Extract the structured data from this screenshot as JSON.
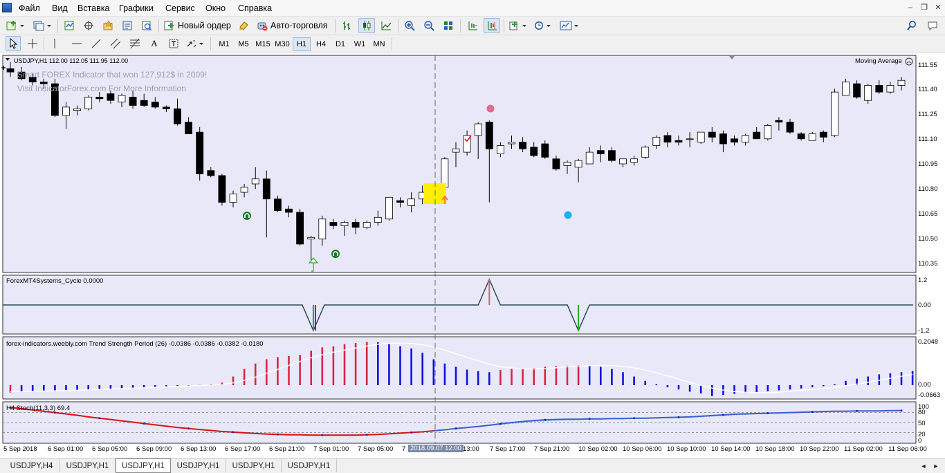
{
  "menu": {
    "items": [
      "Файл",
      "Вид",
      "Вставка",
      "Графики",
      "Сервис",
      "Окно",
      "Справка"
    ]
  },
  "toolbar": {
    "new_order": "Новый ордер",
    "auto_trading": "Авто-торговля"
  },
  "timeframes": {
    "items": [
      "M1",
      "M5",
      "M15",
      "M30",
      "H1",
      "H4",
      "D1",
      "W1",
      "MN"
    ],
    "selected": "H1"
  },
  "chart": {
    "header": "USDJPY,H1  112.00 112.05 111.95 112.00",
    "ad_line1": "Smart FOREX Indicator that won 127,912$ in 2009!",
    "ad_line2": "Visit IndicatorForex.com For More Information",
    "indicator_label": "Moving Average",
    "price_scale": [
      "111.55",
      "111.40",
      "111.25",
      "111.10",
      "110.95",
      "110.80",
      "110.65",
      "110.50",
      "110.35"
    ],
    "cycle": {
      "title": "ForexMT4Systems_Cycle 0.0000",
      "scale": [
        "1.2",
        "0.00",
        "-1.2"
      ]
    },
    "trend": {
      "title": "forex-indicators.weebly.com Trend Strength Period (26) -0.0386 -0.0386 -0.0382 -0.0180",
      "scale": [
        "0.2048",
        "0.00",
        "-0.0663"
      ]
    },
    "stoch": {
      "title": "H4 Stoch(11,3,3)  69.4",
      "scale": [
        "100",
        "80",
        "50",
        "20",
        "0"
      ]
    },
    "time_axis": [
      "5 Sep 2018",
      "6 Sep 01:00",
      "6 Sep 05:00",
      "6 Sep 09:00",
      "6 Sep 13:00",
      "6 Sep 17:00",
      "6 Sep 21:00",
      "7 Sep 01:00",
      "7 Sep 05:00",
      "7",
      "13:00",
      "7 Sep 17:00",
      "7 Sep 21:00",
      "10 Sep 02:00",
      "10 Sep 06:00",
      "10 Sep 10:00",
      "10 Sep 14:00",
      "10 Sep 18:00",
      "10 Sep 22:00",
      "11 Sep 02:00",
      "11 Sep 06:00"
    ],
    "crosshair_time": "2018.09.07 12:00"
  },
  "chart_data": {
    "type": "candlestick",
    "symbol": "USDJPY",
    "timeframe": "H1",
    "ylim": [
      110.3,
      111.6
    ],
    "candles": [
      [
        111.52,
        111.56,
        111.47,
        111.5
      ],
      [
        111.5,
        111.53,
        111.45,
        111.46
      ],
      [
        111.47,
        111.49,
        111.42,
        111.44
      ],
      [
        111.44,
        111.46,
        111.4,
        111.43
      ],
      [
        111.43,
        111.46,
        111.23,
        111.24
      ],
      [
        111.24,
        111.32,
        111.16,
        111.29
      ],
      [
        111.27,
        111.3,
        111.24,
        111.28
      ],
      [
        111.28,
        111.36,
        111.27,
        111.35
      ],
      [
        111.35,
        111.38,
        111.32,
        111.34
      ],
      [
        111.37,
        111.39,
        111.31,
        111.33
      ],
      [
        111.32,
        111.37,
        111.29,
        111.36
      ],
      [
        111.35,
        111.39,
        111.28,
        111.3
      ],
      [
        111.33,
        111.37,
        111.29,
        111.3
      ],
      [
        111.32,
        111.35,
        111.28,
        111.29
      ],
      [
        111.29,
        111.3,
        111.26,
        111.28
      ],
      [
        111.28,
        111.34,
        111.18,
        111.19
      ],
      [
        111.2,
        111.23,
        111.13,
        111.13
      ],
      [
        111.14,
        111.17,
        110.85,
        110.89
      ],
      [
        110.91,
        110.93,
        110.87,
        110.88
      ],
      [
        110.88,
        110.89,
        110.7,
        110.72
      ],
      [
        110.72,
        110.79,
        110.69,
        110.77
      ],
      [
        110.78,
        110.83,
        110.75,
        110.81
      ],
      [
        110.83,
        110.93,
        110.8,
        110.86
      ],
      [
        110.86,
        110.91,
        110.51,
        110.74
      ],
      [
        110.74,
        110.76,
        110.66,
        110.67
      ],
      [
        110.68,
        110.7,
        110.63,
        110.66
      ],
      [
        110.66,
        110.68,
        110.46,
        110.47
      ],
      [
        110.5,
        110.52,
        110.36,
        110.51
      ],
      [
        110.5,
        110.64,
        110.46,
        110.62
      ],
      [
        110.6,
        110.62,
        110.56,
        110.58
      ],
      [
        110.58,
        110.61,
        110.52,
        110.6
      ],
      [
        110.6,
        110.62,
        110.53,
        110.57
      ],
      [
        110.57,
        110.61,
        110.56,
        110.6
      ],
      [
        110.6,
        110.67,
        110.58,
        110.63
      ],
      [
        110.62,
        110.75,
        110.61,
        110.75
      ],
      [
        110.73,
        110.75,
        110.69,
        110.72
      ],
      [
        110.7,
        110.78,
        110.66,
        110.74
      ],
      [
        110.74,
        110.82,
        110.71,
        110.78
      ],
      [
        110.78,
        110.82,
        110.76,
        110.8
      ],
      [
        110.81,
        110.99,
        110.8,
        110.98
      ],
      [
        111.02,
        111.08,
        110.93,
        111.04
      ],
      [
        111.02,
        111.15,
        111.0,
        111.12
      ],
      [
        111.12,
        111.2,
        110.98,
        111.19
      ],
      [
        111.2,
        111.21,
        110.72,
        111.04
      ],
      [
        111.01,
        111.08,
        110.99,
        111.06
      ],
      [
        111.07,
        111.12,
        111.04,
        111.08
      ],
      [
        111.08,
        111.11,
        111.02,
        111.04
      ],
      [
        111.05,
        111.08,
        110.99,
        111.0
      ],
      [
        111.07,
        111.09,
        110.98,
        110.99
      ],
      [
        110.98,
        111.0,
        110.91,
        110.92
      ],
      [
        110.94,
        110.97,
        110.89,
        110.96
      ],
      [
        110.93,
        110.98,
        110.84,
        110.97
      ],
      [
        110.95,
        111.05,
        110.95,
        111.02
      ],
      [
        111.03,
        111.06,
        110.96,
        111.01
      ],
      [
        111.03,
        111.05,
        110.96,
        110.97
      ],
      [
        110.95,
        110.98,
        110.93,
        110.98
      ],
      [
        110.96,
        111.0,
        110.94,
        110.98
      ],
      [
        110.99,
        111.06,
        110.98,
        111.05
      ],
      [
        111.06,
        111.12,
        111.04,
        111.11
      ],
      [
        111.12,
        111.14,
        111.05,
        111.08
      ],
      [
        111.09,
        111.12,
        111.06,
        111.08
      ],
      [
        111.1,
        111.14,
        111.05,
        111.1
      ],
      [
        111.08,
        111.14,
        111.07,
        111.14
      ],
      [
        111.14,
        111.17,
        111.08,
        111.11
      ],
      [
        111.13,
        111.15,
        111.02,
        111.07
      ],
      [
        111.1,
        111.12,
        111.06,
        111.08
      ],
      [
        111.08,
        111.13,
        111.06,
        111.12
      ],
      [
        111.14,
        111.17,
        111.1,
        111.1
      ],
      [
        111.1,
        111.19,
        111.09,
        111.18
      ],
      [
        111.21,
        111.23,
        111.15,
        111.2
      ],
      [
        111.2,
        111.22,
        111.13,
        111.14
      ],
      [
        111.13,
        111.14,
        111.09,
        111.1
      ],
      [
        111.09,
        111.14,
        111.09,
        111.13
      ],
      [
        111.14,
        111.15,
        111.08,
        111.11
      ],
      [
        111.12,
        111.4,
        111.11,
        111.38
      ],
      [
        111.36,
        111.46,
        111.36,
        111.44
      ],
      [
        111.43,
        111.45,
        111.34,
        111.35
      ],
      [
        111.33,
        111.43,
        111.31,
        111.42
      ],
      [
        111.42,
        111.45,
        111.37,
        111.38
      ],
      [
        111.38,
        111.44,
        111.37,
        111.42
      ],
      [
        111.42,
        111.47,
        111.39,
        111.45
      ]
    ],
    "cycle": {
      "range": [
        -1.2,
        1.2
      ],
      "dips": [
        {
          "candle": 27.2,
          "value": -1.2
        },
        {
          "candle": 51,
          "value": -1.2
        }
      ],
      "peaks": [
        {
          "candle": 43,
          "value": 1.2
        }
      ]
    },
    "trend_strength": {
      "range": [
        -0.0663,
        0.2048
      ],
      "values": [
        -0.034,
        -0.032,
        -0.03,
        -0.028,
        -0.026,
        -0.024,
        -0.022,
        -0.02,
        -0.018,
        -0.016,
        -0.014,
        -0.012,
        -0.01,
        -0.008,
        -0.006,
        -0.004,
        -0.002,
        0.002,
        0.006,
        0.012,
        0.04,
        0.075,
        0.1,
        0.12,
        0.13,
        0.135,
        0.14,
        0.16,
        0.175,
        0.18,
        0.19,
        0.195,
        0.2,
        0.198,
        0.19,
        0.18,
        0.17,
        0.15,
        0.12,
        0.1,
        0.085,
        0.072,
        0.065,
        0.06,
        0.07,
        0.075,
        0.078,
        0.08,
        0.085,
        0.088,
        0.09,
        0.092,
        0.09,
        0.085,
        0.075,
        0.06,
        0.04,
        0.02,
        0.005,
        -0.01,
        -0.02,
        -0.03,
        -0.038,
        -0.05,
        -0.045,
        -0.04,
        -0.036,
        -0.032,
        -0.028,
        -0.024,
        -0.02,
        -0.015,
        -0.01,
        -0.005,
        0.005,
        0.02,
        0.03,
        0.04,
        0.05,
        0.055,
        0.06,
        0.065
      ]
    },
    "stoch_main": [
      95,
      92,
      88,
      84,
      80,
      76,
      72,
      67,
      63,
      59,
      55,
      51,
      47,
      43,
      39,
      35,
      32,
      29,
      26,
      23,
      21,
      19,
      17,
      15,
      14,
      13,
      13,
      12,
      12,
      12,
      12,
      12,
      13,
      14,
      16,
      18,
      20,
      22,
      25,
      28,
      32,
      35,
      38,
      42,
      46,
      50,
      53,
      56,
      58,
      59,
      60,
      60,
      61,
      61,
      62,
      62,
      63,
      63,
      64,
      65,
      66,
      67,
      69,
      71,
      73,
      75,
      76,
      77,
      78,
      79,
      80,
      81,
      82,
      83,
      84,
      84,
      85,
      85,
      85,
      86,
      86
    ],
    "stoch_signal": [
      93,
      90,
      86,
      82,
      78,
      74,
      70,
      66,
      62,
      58,
      54,
      50,
      46,
      42,
      38,
      35,
      32,
      29,
      27,
      24,
      22,
      20,
      19,
      17,
      16,
      15,
      14,
      13,
      13,
      13,
      13,
      14,
      14,
      15,
      17,
      19,
      21,
      23,
      26,
      29,
      32,
      35,
      38,
      41,
      44,
      47,
      50,
      53,
      55,
      57,
      58,
      59,
      60,
      60,
      61,
      61,
      62,
      62,
      63,
      64,
      65,
      66,
      67,
      69,
      71,
      73,
      74,
      76,
      77,
      78,
      79,
      80,
      81,
      82,
      83,
      83,
      84,
      84,
      84,
      85,
      85
    ]
  }
}
